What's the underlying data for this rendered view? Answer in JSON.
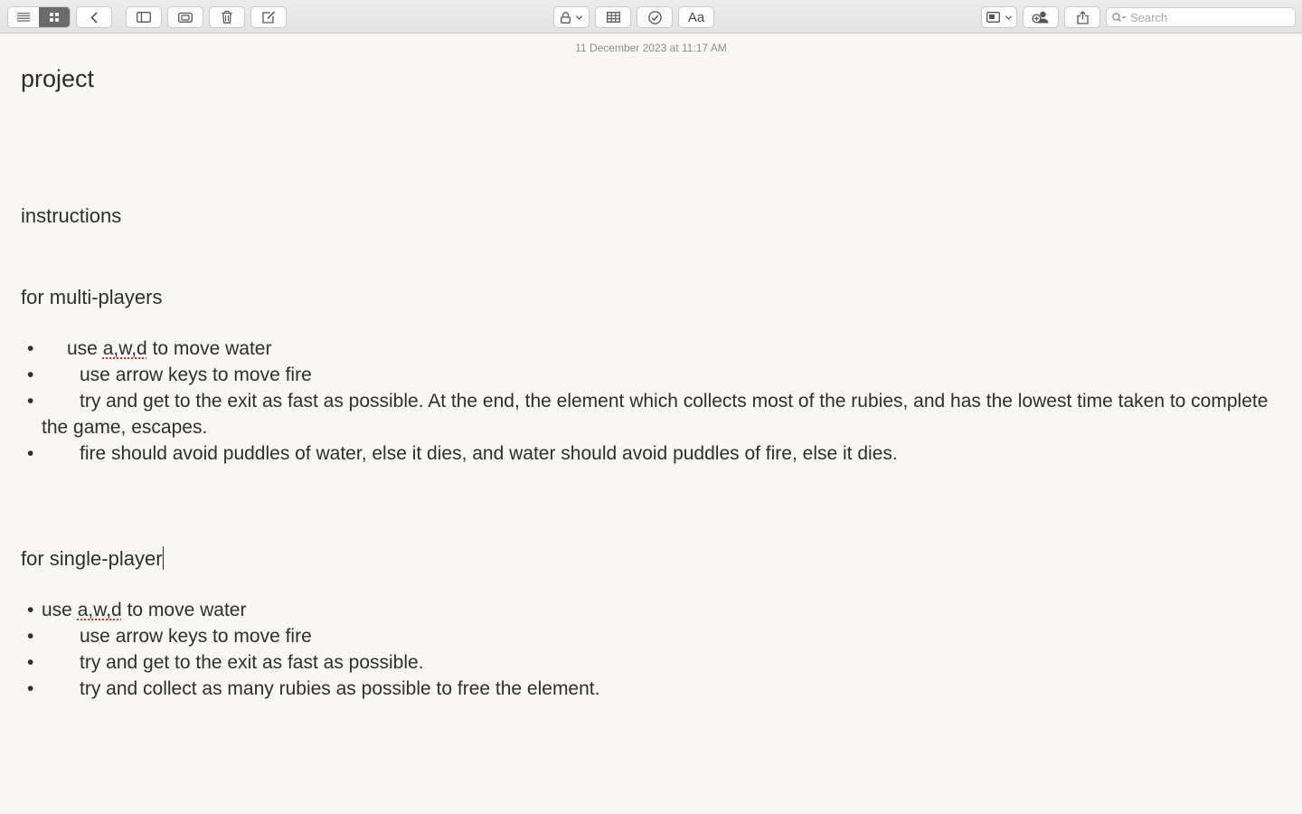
{
  "toolbar": {
    "buttons": [
      {
        "name": "list-view",
        "icon": "list-icon"
      },
      {
        "name": "gallery-view",
        "icon": "grid-icon"
      },
      {
        "name": "back",
        "icon": "chevron-left-icon"
      },
      {
        "name": "sidebar",
        "icon": "sidebar-icon"
      },
      {
        "name": "attachments",
        "icon": "attachments-icon"
      },
      {
        "name": "delete",
        "icon": "trash-icon"
      },
      {
        "name": "compose",
        "icon": "compose-icon"
      },
      {
        "name": "lock",
        "icon": "lock-icon"
      },
      {
        "name": "table",
        "icon": "table-icon"
      },
      {
        "name": "checklist",
        "icon": "checkmark-circle-icon"
      },
      {
        "name": "format",
        "icon": "format-icon"
      },
      {
        "name": "media",
        "icon": "photo-icon"
      },
      {
        "name": "collaborate",
        "icon": "collaborate-icon"
      },
      {
        "name": "share",
        "icon": "share-icon"
      }
    ],
    "format_label": "Aa",
    "search_placeholder": "Search",
    "search_value": ""
  },
  "note": {
    "timestamp": "11 December 2023 at 11:17 AM",
    "title": "project",
    "instructions_heading": "instructions",
    "multi_heading": "for multi-players",
    "multi_items": [
      {
        "before": "use ",
        "misspelled": "a,w,d",
        "after": " to move water"
      },
      {
        "text": "use arrow keys to move fire"
      },
      {
        "text": "try and get to the exit as fast as possible. At the end, the element which collects most of the rubies, and has the lowest time taken to complete the game, escapes."
      },
      {
        "text": "fire should avoid puddles of water, else it dies, and water should avoid puddles of fire, else it dies."
      }
    ],
    "single_heading": "for single-player",
    "single_items": [
      {
        "before": "use ",
        "misspelled": "a,w,d",
        "after": " to move water"
      },
      {
        "text": "use arrow keys to move fire"
      },
      {
        "text": "try and get to the exit as fast as possible."
      },
      {
        "text": "try and collect as many rubies as possible to free the element."
      }
    ],
    "bullet": "•"
  },
  "colors": {
    "background": "#f8f7f4",
    "text": "#2e2e2e",
    "timestamp": "#8e8e8e",
    "spellcheck": "#d9342b",
    "active_segment": "#6b6b6b"
  }
}
